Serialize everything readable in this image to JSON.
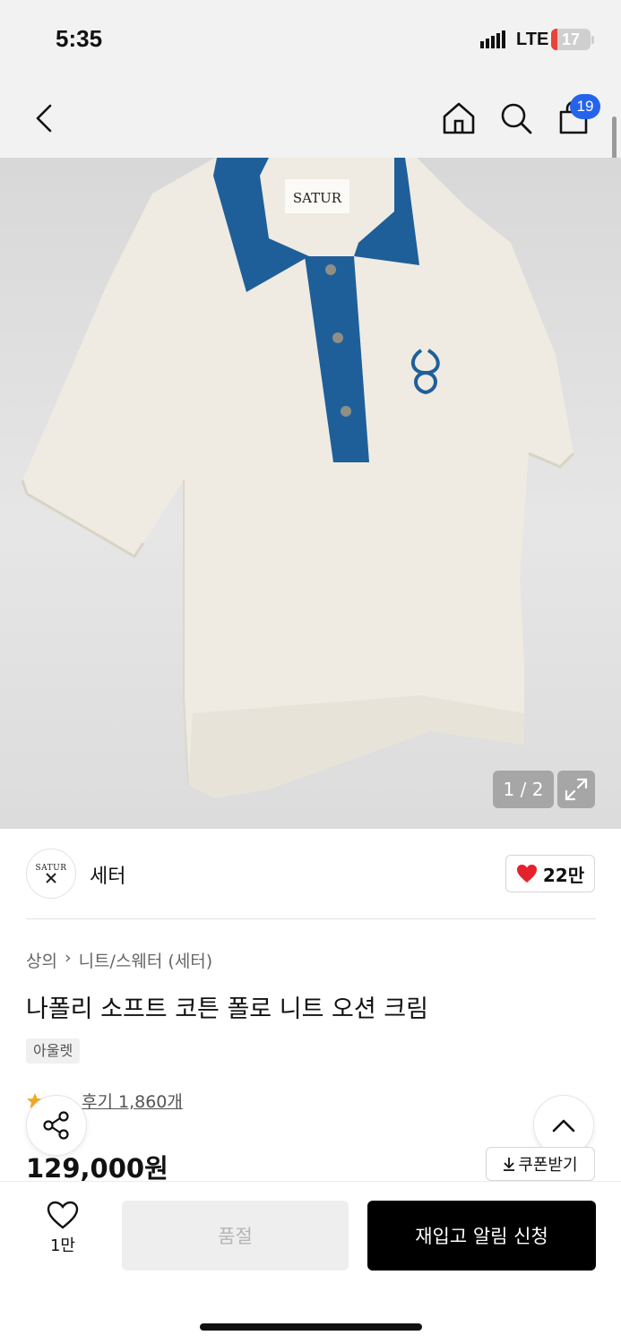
{
  "status_bar": {
    "time": "5:35",
    "network": "LTE",
    "battery": "17",
    "battery_percent": 17
  },
  "nav": {
    "back_icon": "chevron-left-icon",
    "home_icon": "home-icon",
    "search_icon": "search-icon",
    "cart_icon": "shopping-bag-icon",
    "cart_count": "19"
  },
  "gallery": {
    "counter": "1 / 2",
    "expand_icon": "expand-icon",
    "label_text": "SATUR"
  },
  "brand": {
    "logo_text": "SATUR",
    "name": "세터",
    "likes": "22만",
    "accent": "#e4222c"
  },
  "product": {
    "breadcrumb": [
      "상의",
      "니트/스웨터 (세터)"
    ],
    "title": "나폴리 소프트 코튼 폴로 니트 오션 크림",
    "tag": "아울렛",
    "reviews": "후기 1,860개",
    "price": "129,000원",
    "coupon_label": "쿠폰받기"
  },
  "bottom_bar": {
    "wish_count": "1만",
    "sold_out_label": "품절",
    "restock_label": "재입고 알림 신청"
  },
  "colors": {
    "accent_blue": "#2563eb",
    "primary_button": "#000000",
    "collar_blue": "#1f5f99"
  }
}
